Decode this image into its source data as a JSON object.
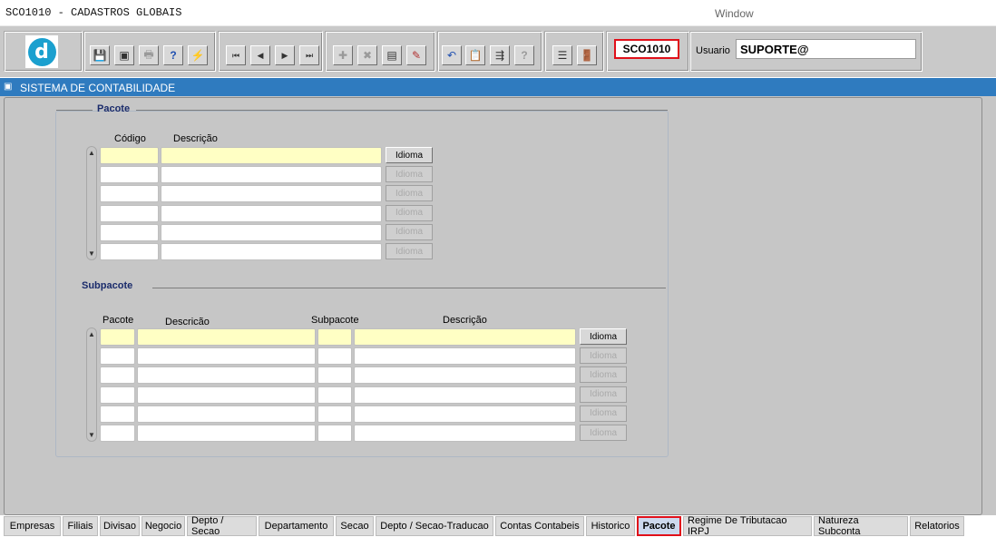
{
  "window": {
    "title": "SCO1010 - CADASTROS GLOBAIS",
    "menu": "Window"
  },
  "toolbar": {
    "logo_letter": "d",
    "form_code": "SCO1010",
    "user_label": "Usuario",
    "user_value": "SUPORTE@",
    "icons": {
      "save": "💾",
      "print_preview": "▣",
      "print": "🖶",
      "query": "?",
      "execute": "⚡",
      "first": "⏮",
      "prev": "◀",
      "next": "▶",
      "last": "⏭",
      "insert": "✚",
      "delete": "✖",
      "clear": "▤",
      "edit": "✎",
      "undo": "↶",
      "clipboard": "📋",
      "list": "⇶",
      "help": "?",
      "menu": "☰",
      "exit": "🚪"
    }
  },
  "system_bar": {
    "title": "SISTEMA DE CONTABILIDADE"
  },
  "pacote": {
    "title": "Pacote",
    "headers": {
      "codigo": "Código",
      "descricao": "Descrição"
    },
    "button_label": "Idioma"
  },
  "subpacote": {
    "title": "Subpacote",
    "headers": {
      "pacote": "Pacote",
      "descricao1": "Descricão",
      "subpacote": "Subpacote",
      "descricao2": "Descrição"
    },
    "button_label": "Idioma"
  },
  "tabs": [
    "Empresas",
    "Filiais",
    "Divisao",
    "Negocio",
    "Depto / Secao",
    "Departamento",
    "Secao",
    "Depto / Secao-Traducao",
    "Contas Contabeis",
    "Historico",
    "Pacote",
    "Regime De Tributacao IRPJ",
    "Natureza Subconta",
    "Relatorios"
  ],
  "active_tab": "Pacote",
  "colors": {
    "system_bar": "#2f7bbf",
    "highlight_border": "#e0101a",
    "current_row": "#ffffc4"
  }
}
